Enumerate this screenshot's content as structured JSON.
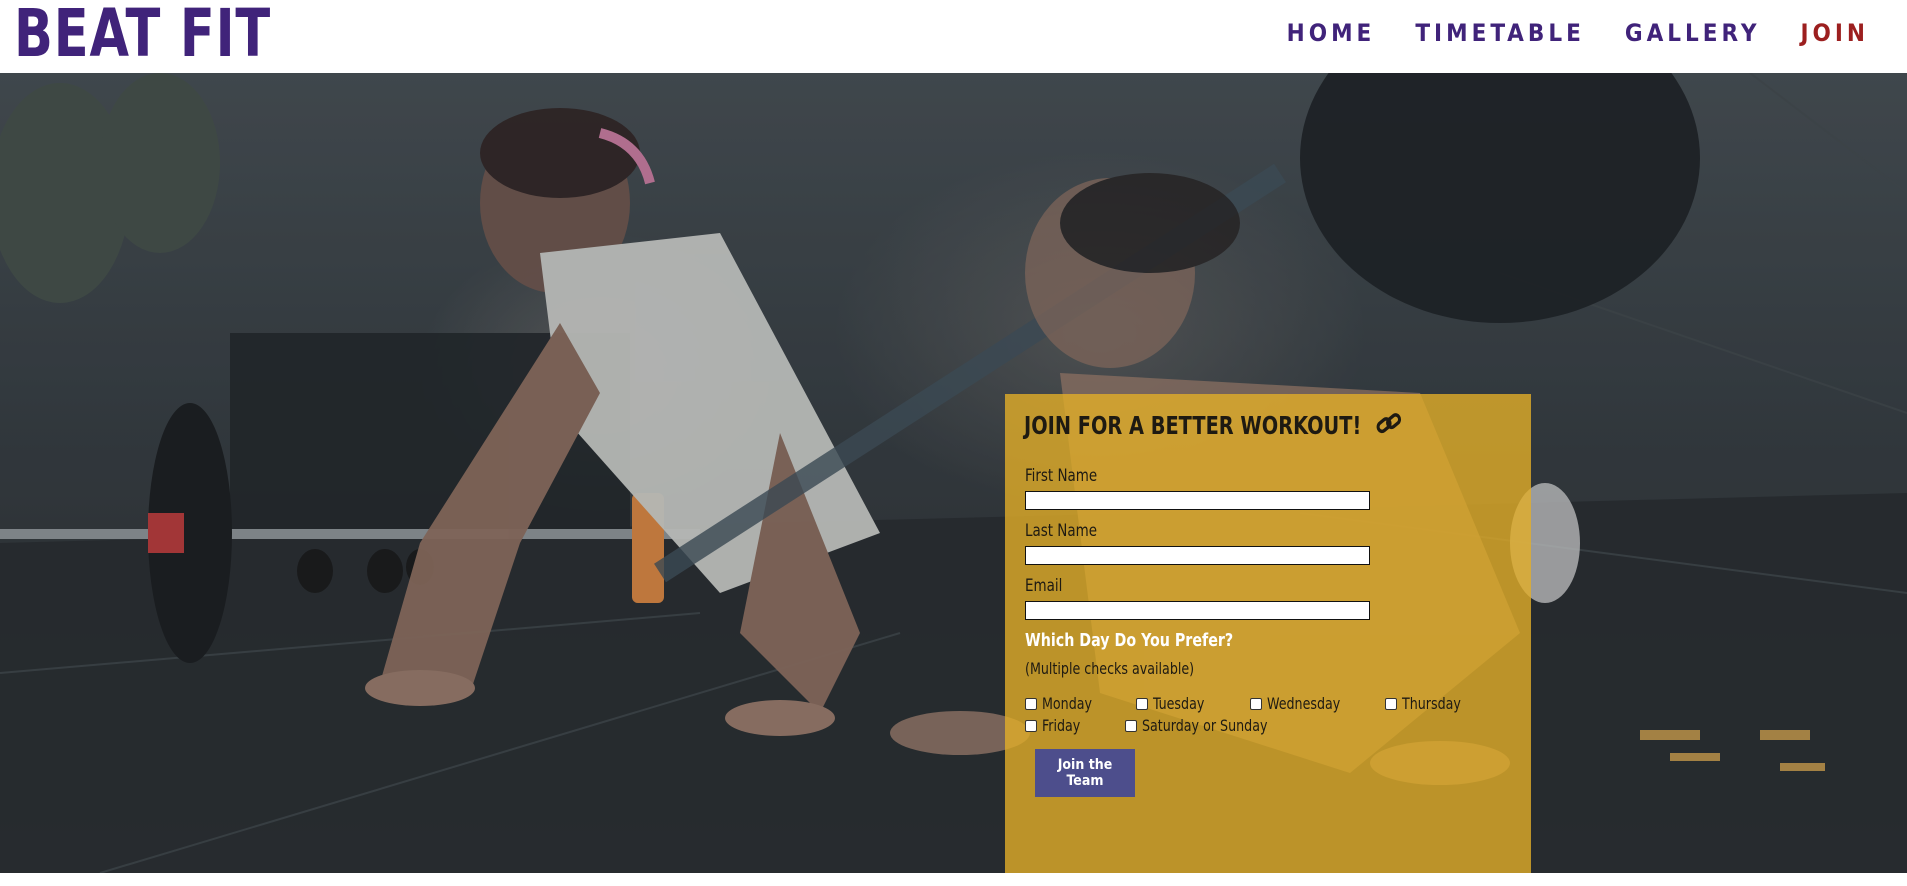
{
  "header": {
    "logo": "BEAT FIT",
    "nav": [
      "HOME",
      "TIMETABLE",
      "GALLERY",
      "JOIN"
    ],
    "active_nav": "JOIN"
  },
  "form": {
    "title": "JOIN FOR A BETTER WORKOUT!",
    "title_icon": "link-icon",
    "fields": {
      "first_name_label": "First Name",
      "first_name_value": "",
      "last_name_label": "Last Name",
      "last_name_value": "",
      "email_label": "Email",
      "email_value": ""
    },
    "question": "Which Day Do You Prefer?",
    "hint": "(Multiple checks available)",
    "days": [
      "Monday",
      "Tuesday",
      "Wednesday",
      "Thursday",
      "Friday",
      "Saturday or Sunday"
    ],
    "submit_label": "Join the Team"
  },
  "colors": {
    "brand": "#40237a",
    "active_nav": "#9c1f1f",
    "panel": "#e2ae28",
    "button": "#4d4e8c"
  }
}
